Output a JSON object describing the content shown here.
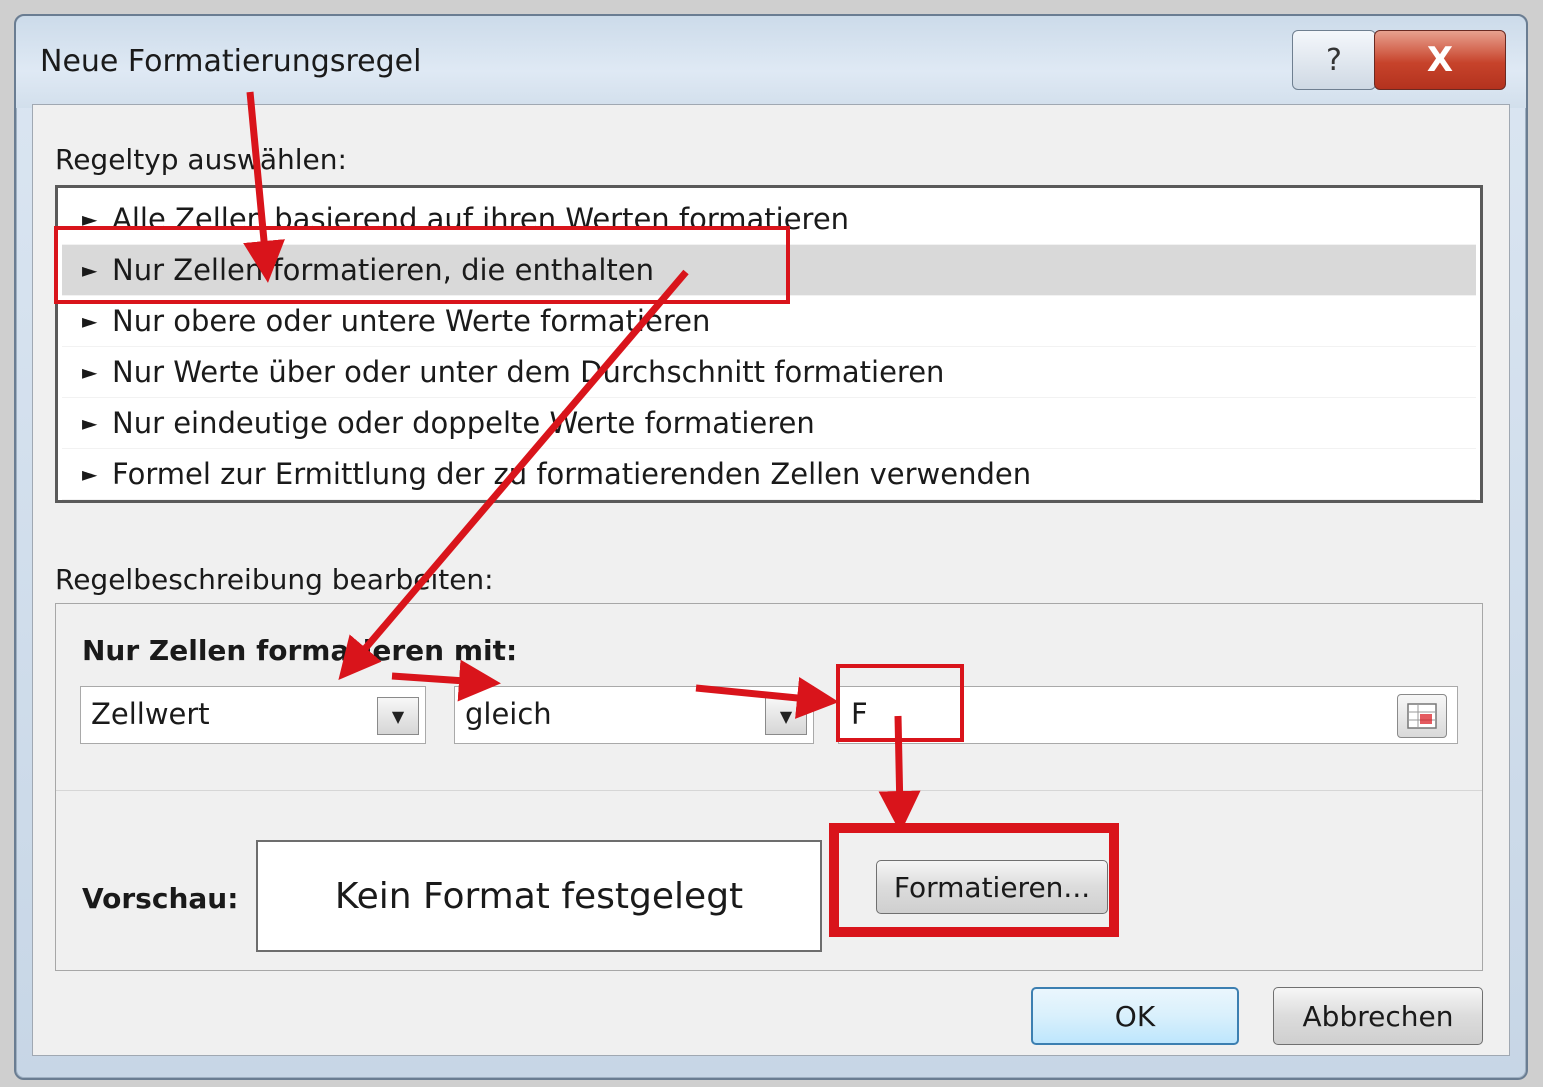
{
  "dialog": {
    "title": "Neue Formatierungsregel",
    "help_glyph": "?",
    "close_glyph": "X"
  },
  "ruletype": {
    "label": "Regeltyp auswählen:",
    "items": [
      {
        "label": "Alle Zellen basierend auf ihren Werten formatieren"
      },
      {
        "label": "Nur Zellen formatieren, die enthalten",
        "selected": true
      },
      {
        "label": "Nur obere oder untere Werte formatieren"
      },
      {
        "label": "Nur Werte über oder unter dem Durchschnitt formatieren"
      },
      {
        "label": "Nur eindeutige oder doppelte Werte formatieren"
      },
      {
        "label": "Formel zur Ermittlung der zu formatierenden Zellen verwenden"
      }
    ],
    "item_bullet": "►"
  },
  "description": {
    "label": "Regelbeschreibung bearbeiten:",
    "format_only_label": "Nur Zellen formatieren mit:",
    "condition_type": "Zellwert",
    "operator": "gleich",
    "value": "F",
    "dropdown_glyph": "▼",
    "preview_label": "Vorschau:",
    "preview_text": "Kein Format festgelegt",
    "format_button": "Formatieren..."
  },
  "footer": {
    "ok_label": "OK",
    "cancel_label": "Abbrechen"
  },
  "colors": {
    "annotation_red": "#d9141b",
    "selection_gray": "#d9d9d9"
  }
}
